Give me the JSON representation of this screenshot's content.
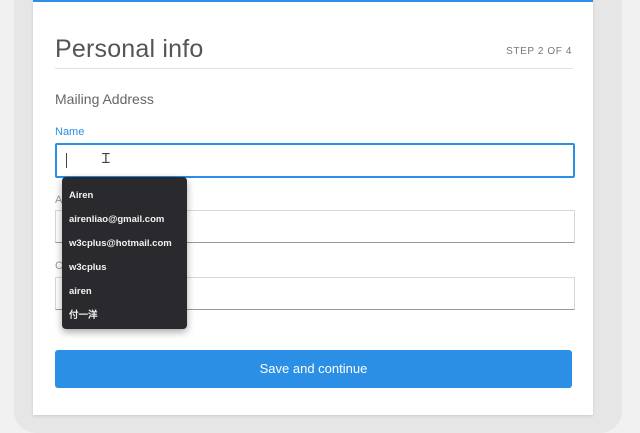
{
  "header": {
    "title": "Personal info",
    "step": "STEP 2 OF 4"
  },
  "section": {
    "heading": "Mailing Address"
  },
  "fields": {
    "name_label": "Name",
    "name_value": "",
    "address_label": "A",
    "address_value": "",
    "city_label": "C",
    "city_value": ""
  },
  "autocomplete": {
    "items": [
      "Airen",
      "airenliao@gmail.com",
      "w3cplus@hotmail.com",
      "w3cplus",
      "airen",
      "付一洋"
    ]
  },
  "actions": {
    "save_label": "Save and continue"
  },
  "colors": {
    "accent": "#2b8fe6",
    "dropdown_bg": "#2a2a2e"
  }
}
